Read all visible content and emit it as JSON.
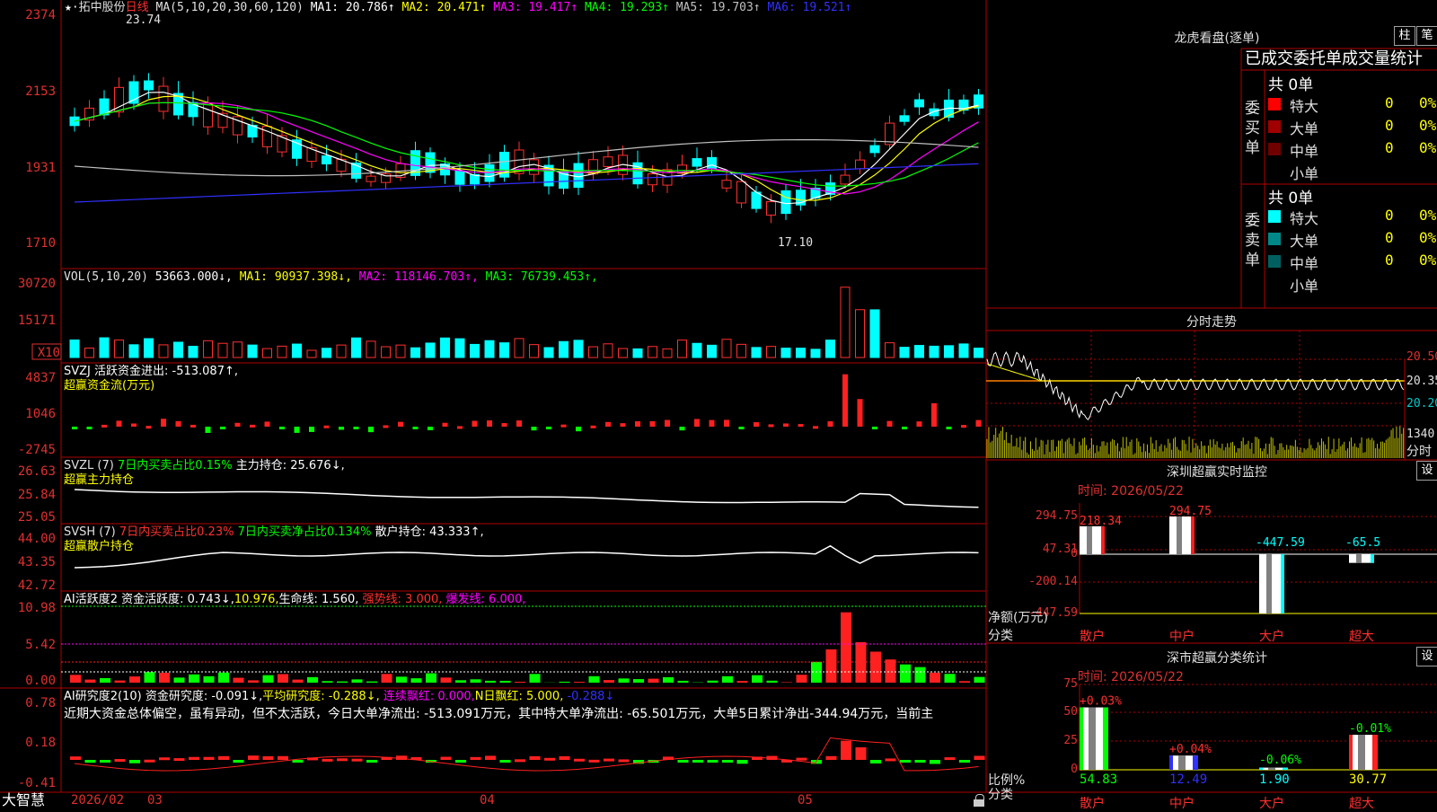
{
  "main_header": {
    "stock": "拓中股份",
    "period": "日线",
    "ma_label": "MA(5,10,20,30,60,120)",
    "ma": [
      {
        "text": "MA1: 20.786↑",
        "color": "#ffffff"
      },
      {
        "text": "MA2: 20.471↑",
        "color": "#ffff00"
      },
      {
        "text": "MA3: 19.417↑",
        "color": "#ff00ff"
      },
      {
        "text": "MA4: 19.293↑",
        "color": "#00ff00"
      },
      {
        "text": "MA5: 19.703↑",
        "color": "#c0c0c0"
      },
      {
        "text": "MA6: 19.521↑",
        "color": "#3030ff"
      }
    ],
    "high_label": "23.74",
    "low_label": "17.10"
  },
  "price_axis": [
    "2374",
    "2153",
    "1931",
    "1710"
  ],
  "vol_header": {
    "label": "VOL(5,10,20)",
    "value": "53663.000↓",
    "ma": [
      {
        "text": "MA1: 90937.398↓",
        "color": "#ffff00"
      },
      {
        "text": "MA2: 118146.703↑",
        "color": "#ff00ff"
      },
      {
        "text": "MA3: 76739.453↑",
        "color": "#00ff00"
      }
    ]
  },
  "vol_axis": [
    "30720",
    "15171"
  ],
  "vol_unit": "X10",
  "svzj": {
    "line1": "SVZJ  活跃资金进出: -513.087↑,",
    "line2": "超赢资金流(万元)",
    "axis": [
      "4837",
      "1046",
      "-2745"
    ]
  },
  "svzl": {
    "label": "SVZL (7)",
    "p1": "7日内买卖占比0.15%",
    "p2": "主力持仓: 25.676↓,",
    "line2": "超赢主力持仓",
    "axis": [
      "26.63",
      "25.84",
      "25.05"
    ]
  },
  "svsh": {
    "label": "SVSH (7)",
    "p1": "7日内买卖占比0.23%",
    "p2": "7日内买卖净占比0.134%",
    "p3": "散户持仓: 43.333↑,",
    "line2": "超赢散户持仓",
    "axis": [
      "44.00",
      "43.35",
      "42.72"
    ]
  },
  "ai1": {
    "p1": "AI活跃度2 资金活跃度: 0.743↓,",
    "p2": "10.976,",
    "p3": "生命线: 1.560,",
    "p4": "强势线: 3.000,",
    "p5": "爆发线: 6.000,",
    "axis": [
      "10.98",
      "5.42",
      "0.00"
    ]
  },
  "ai2": {
    "p1": "AI研究度2(10) 资金研究度: -0.091↓,",
    "p2": "平均研究度: -0.288↓,",
    "p3": "连续飘红: 0.000,",
    "p4": "N日飘红: 5.000,",
    "p5": "-0.288↓",
    "text": "近期大资金总体偏空，虽有异动，但不太活跃，今日大单净流出: -513.091万元，其中特大单净流出: -65.501万元，大单5日累计净出-344.94万元，当前主",
    "axis": [
      "0.78",
      "0.18",
      "-0.41"
    ]
  },
  "bottom_bar": {
    "brand": "大智慧",
    "dates": [
      "2026/02",
      "03",
      "04",
      "05"
    ]
  },
  "order_book": {
    "title": "龙虎看盘(逐单)",
    "btn1": "柱",
    "btn2": "笔",
    "tabs": "已成交委托单成交量统计",
    "buy_label": "委买单",
    "sell_label": "委卖单",
    "buy_total": "共 0单",
    "sell_total": "共 0单",
    "buy": [
      {
        "label": "特大",
        "color": "#ff0000",
        "v1": "0",
        "v2": "0%"
      },
      {
        "label": "大单",
        "color": "#a00000",
        "v1": "0",
        "v2": "0%"
      },
      {
        "label": "中单",
        "color": "#700000",
        "v1": "0",
        "v2": "0%"
      },
      {
        "label": "小单",
        "color": "#000000",
        "v1": "",
        "v2": ""
      }
    ],
    "sell": [
      {
        "label": "特大",
        "color": "#00ffff",
        "v1": "0",
        "v2": "0%"
      },
      {
        "label": "大单",
        "color": "#008888",
        "v1": "0",
        "v2": "0%"
      },
      {
        "label": "中单",
        "color": "#006060",
        "v1": "0",
        "v2": "0%"
      },
      {
        "label": "小单",
        "color": "#000000",
        "v1": "",
        "v2": ""
      }
    ]
  },
  "intraday": {
    "title": "分时走势",
    "axis": [
      "20.50",
      "20.35",
      "20.20"
    ],
    "vol": "1340",
    "vol_unit": "分时"
  },
  "monitor": {
    "title": "深圳超赢实时监控",
    "setting": "设",
    "time": "时间: 2026/05/22",
    "axis": [
      "294.75",
      "47.31",
      "0",
      "-200.14",
      "-447.59"
    ],
    "ylabel": "净额(万元)",
    "xlabel": "分类",
    "cats": [
      "散户",
      "中户",
      "大户",
      "超大"
    ],
    "values": [
      218.34,
      294.75,
      -447.59,
      -65.5
    ],
    "value_labels": [
      "218.34",
      "294.75",
      "-447.59",
      "-65.5"
    ]
  },
  "classify": {
    "title": "深市超赢分类统计",
    "setting": "设",
    "time": "时间: 2026/05/22",
    "axis": [
      "75",
      "50",
      "25",
      "0"
    ],
    "ylabel": "比例%",
    "xlabel": "分类",
    "cats": [
      "散户",
      "中户",
      "大户",
      "超大"
    ],
    "values": [
      54.83,
      12.49,
      1.9,
      30.77
    ],
    "value_labels": [
      "54.83",
      "12.49",
      "1.90",
      "30.77"
    ],
    "changes": [
      "+0.03%",
      "+0.04%",
      "-0.06%",
      "-0.01%"
    ]
  }
}
